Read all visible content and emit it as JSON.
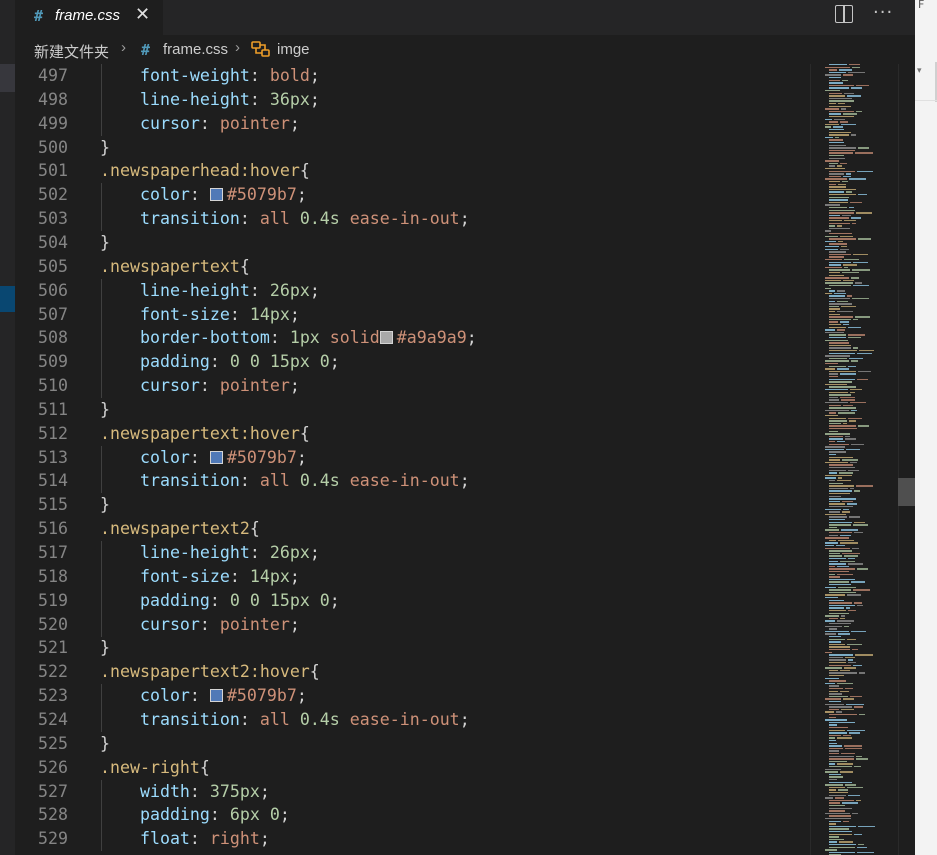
{
  "tab": {
    "icon": "css-file-icon",
    "title": "frame.css",
    "close": "✕"
  },
  "breadcrumb": {
    "folder": "新建文件夹",
    "file": "frame.css",
    "symbol": "imge"
  },
  "colors": {
    "accent": "#519aba",
    "selector": "#d7ba7d",
    "property": "#9cdcfe",
    "number": "#b5cea8",
    "string": "#ce9178",
    "swatch_blue": "#5079b7",
    "swatch_gray": "#a9a9a9"
  },
  "lines": [
    {
      "n": "497",
      "t": [
        [
          "i",
          ""
        ],
        [
          "prop",
          "font-weight"
        ],
        [
          "punc",
          ": "
        ],
        [
          "kw",
          "bold"
        ],
        [
          "punc",
          ";"
        ]
      ]
    },
    {
      "n": "498",
      "t": [
        [
          "i",
          ""
        ],
        [
          "prop",
          "line-height"
        ],
        [
          "punc",
          ": "
        ],
        [
          "num",
          "36px"
        ],
        [
          "punc",
          ";"
        ]
      ]
    },
    {
      "n": "499",
      "t": [
        [
          "i",
          ""
        ],
        [
          "prop",
          "cursor"
        ],
        [
          "punc",
          ": "
        ],
        [
          "kw",
          "pointer"
        ],
        [
          "punc",
          ";"
        ]
      ]
    },
    {
      "n": "500",
      "t": [
        [
          "brace",
          "}"
        ]
      ]
    },
    {
      "n": "501",
      "t": [
        [
          "sel",
          ".newspaperhead:hover"
        ],
        [
          "brace",
          "{"
        ]
      ]
    },
    {
      "n": "502",
      "t": [
        [
          "i",
          ""
        ],
        [
          "prop",
          "color"
        ],
        [
          "punc",
          ": "
        ],
        [
          "sw",
          "#5079b7"
        ],
        [
          "hex",
          "#5079b7"
        ],
        [
          "punc",
          ";"
        ]
      ]
    },
    {
      "n": "503",
      "t": [
        [
          "i",
          ""
        ],
        [
          "prop",
          "transition"
        ],
        [
          "punc",
          ": "
        ],
        [
          "kw",
          "all "
        ],
        [
          "num",
          "0.4s "
        ],
        [
          "kw",
          "ease-in-out"
        ],
        [
          "punc",
          ";"
        ]
      ]
    },
    {
      "n": "504",
      "t": [
        [
          "brace",
          "}"
        ]
      ]
    },
    {
      "n": "505",
      "t": [
        [
          "sel",
          ".newspapertext"
        ],
        [
          "brace",
          "{"
        ]
      ]
    },
    {
      "n": "506",
      "t": [
        [
          "i",
          ""
        ],
        [
          "prop",
          "line-height"
        ],
        [
          "punc",
          ": "
        ],
        [
          "num",
          "26px"
        ],
        [
          "punc",
          ";"
        ]
      ]
    },
    {
      "n": "507",
      "t": [
        [
          "i",
          ""
        ],
        [
          "prop",
          "font-size"
        ],
        [
          "punc",
          ": "
        ],
        [
          "num",
          "14px"
        ],
        [
          "punc",
          ";"
        ]
      ]
    },
    {
      "n": "508",
      "t": [
        [
          "i",
          ""
        ],
        [
          "prop",
          "border-bottom"
        ],
        [
          "punc",
          ": "
        ],
        [
          "num",
          "1px "
        ],
        [
          "kw",
          "solid"
        ],
        [
          "sw",
          "#a9a9a9"
        ],
        [
          "hex",
          "#a9a9a9"
        ],
        [
          "punc",
          ";"
        ]
      ]
    },
    {
      "n": "509",
      "t": [
        [
          "i",
          ""
        ],
        [
          "prop",
          "padding"
        ],
        [
          "punc",
          ": "
        ],
        [
          "num",
          "0 0 15px 0"
        ],
        [
          "punc",
          ";"
        ]
      ]
    },
    {
      "n": "510",
      "t": [
        [
          "i",
          ""
        ],
        [
          "prop",
          "cursor"
        ],
        [
          "punc",
          ": "
        ],
        [
          "kw",
          "pointer"
        ],
        [
          "punc",
          ";"
        ]
      ]
    },
    {
      "n": "511",
      "t": [
        [
          "brace",
          "}"
        ]
      ]
    },
    {
      "n": "512",
      "t": [
        [
          "sel",
          ".newspapertext:hover"
        ],
        [
          "brace",
          "{"
        ]
      ]
    },
    {
      "n": "513",
      "t": [
        [
          "i",
          ""
        ],
        [
          "prop",
          "color"
        ],
        [
          "punc",
          ": "
        ],
        [
          "sw",
          "#5079b7"
        ],
        [
          "hex",
          "#5079b7"
        ],
        [
          "punc",
          ";"
        ]
      ]
    },
    {
      "n": "514",
      "t": [
        [
          "i",
          ""
        ],
        [
          "prop",
          "transition"
        ],
        [
          "punc",
          ": "
        ],
        [
          "kw",
          "all "
        ],
        [
          "num",
          "0.4s "
        ],
        [
          "kw",
          "ease-in-out"
        ],
        [
          "punc",
          ";"
        ]
      ]
    },
    {
      "n": "515",
      "t": [
        [
          "brace",
          "}"
        ]
      ]
    },
    {
      "n": "516",
      "t": [
        [
          "sel",
          ".newspapertext2"
        ],
        [
          "brace",
          "{"
        ]
      ]
    },
    {
      "n": "517",
      "t": [
        [
          "i",
          ""
        ],
        [
          "prop",
          "line-height"
        ],
        [
          "punc",
          ": "
        ],
        [
          "num",
          "26px"
        ],
        [
          "punc",
          ";"
        ]
      ]
    },
    {
      "n": "518",
      "t": [
        [
          "i",
          ""
        ],
        [
          "prop",
          "font-size"
        ],
        [
          "punc",
          ": "
        ],
        [
          "num",
          "14px"
        ],
        [
          "punc",
          ";"
        ]
      ]
    },
    {
      "n": "519",
      "t": [
        [
          "i",
          ""
        ],
        [
          "prop",
          "padding"
        ],
        [
          "punc",
          ": "
        ],
        [
          "num",
          "0 0 15px 0"
        ],
        [
          "punc",
          ";"
        ]
      ]
    },
    {
      "n": "520",
      "t": [
        [
          "i",
          ""
        ],
        [
          "prop",
          "cursor"
        ],
        [
          "punc",
          ": "
        ],
        [
          "kw",
          "pointer"
        ],
        [
          "punc",
          ";"
        ]
      ]
    },
    {
      "n": "521",
      "t": [
        [
          "brace",
          "}"
        ]
      ]
    },
    {
      "n": "522",
      "t": [
        [
          "sel",
          ".newspapertext2:hover"
        ],
        [
          "brace",
          "{"
        ]
      ]
    },
    {
      "n": "523",
      "t": [
        [
          "i",
          ""
        ],
        [
          "prop",
          "color"
        ],
        [
          "punc",
          ": "
        ],
        [
          "sw",
          "#5079b7"
        ],
        [
          "hex",
          "#5079b7"
        ],
        [
          "punc",
          ";"
        ]
      ]
    },
    {
      "n": "524",
      "t": [
        [
          "i",
          ""
        ],
        [
          "prop",
          "transition"
        ],
        [
          "punc",
          ": "
        ],
        [
          "kw",
          "all "
        ],
        [
          "num",
          "0.4s "
        ],
        [
          "kw",
          "ease-in-out"
        ],
        [
          "punc",
          ";"
        ]
      ]
    },
    {
      "n": "525",
      "t": [
        [
          "brace",
          "}"
        ]
      ]
    },
    {
      "n": "526",
      "t": [
        [
          "sel",
          ".new-right"
        ],
        [
          "brace",
          "{"
        ]
      ]
    },
    {
      "n": "527",
      "t": [
        [
          "i",
          ""
        ],
        [
          "prop",
          "width"
        ],
        [
          "punc",
          ": "
        ],
        [
          "num",
          "375px"
        ],
        [
          "punc",
          ";"
        ]
      ]
    },
    {
      "n": "528",
      "t": [
        [
          "i",
          ""
        ],
        [
          "prop",
          "padding"
        ],
        [
          "punc",
          ": "
        ],
        [
          "num",
          "6px 0"
        ],
        [
          "punc",
          ";"
        ]
      ]
    },
    {
      "n": "529",
      "t": [
        [
          "i",
          ""
        ],
        [
          "prop",
          "float"
        ],
        [
          "punc",
          ": "
        ],
        [
          "kw",
          "right"
        ],
        [
          "punc",
          ";"
        ]
      ]
    }
  ]
}
